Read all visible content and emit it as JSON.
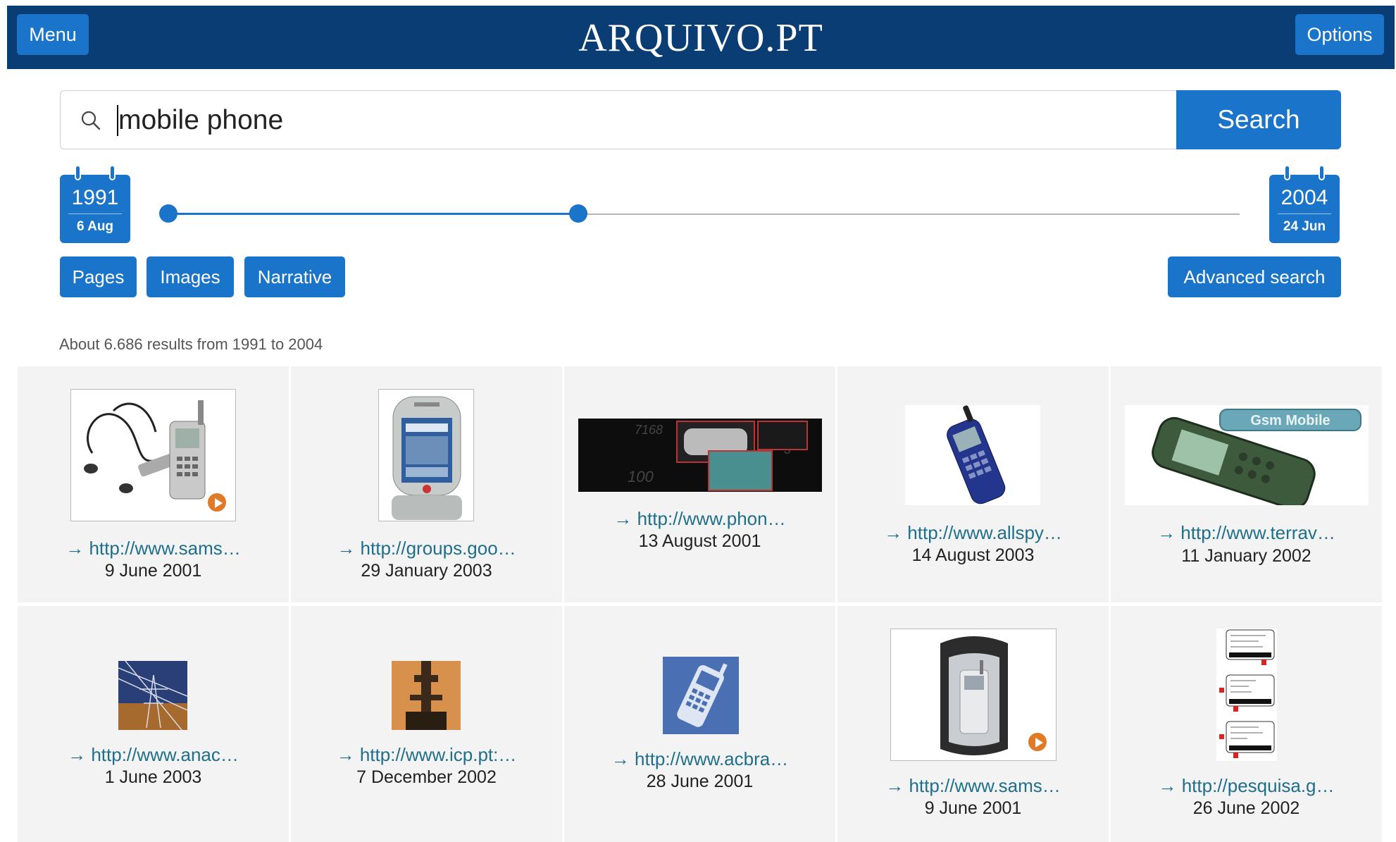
{
  "header": {
    "menu_label": "Menu",
    "logo_text": "ARQUIVO.PT",
    "options_label": "Options"
  },
  "search": {
    "query": "mobile phone",
    "button_label": "Search"
  },
  "date_range": {
    "start": {
      "year": "1991",
      "day": "6 Aug"
    },
    "end": {
      "year": "2004",
      "day": "24 Jun"
    },
    "selected_fraction": [
      0.0,
      0.4
    ]
  },
  "tabs": {
    "pages": "Pages",
    "images": "Images",
    "narrative": "Narrative",
    "advanced": "Advanced search"
  },
  "results_summary": "About 6.686 results from 1991 to 2004",
  "results": [
    {
      "url": "→ http://www.sams…",
      "date": "9 June 2001",
      "thumb": "phone-with-earphones",
      "video": true
    },
    {
      "url": "→ http://groups.goo…",
      "date": "29 January 2003",
      "thumb": "samsung-flip-phone",
      "video": false
    },
    {
      "url": "→ http://www.phon…",
      "date": "13 August 2001",
      "thumb": "dark-keypad-banner",
      "video": false
    },
    {
      "url": "→ http://www.allspy…",
      "date": "14 August 2003",
      "thumb": "blue-mobile-phone",
      "video": false
    },
    {
      "url": "→ http://www.terrav…",
      "date": "11 January 2002",
      "thumb": "gsm-mobile-banner",
      "video": false,
      "banner_text": "Gsm Mobile"
    },
    {
      "url": "→ http://www.anac…",
      "date": "1 June 2003",
      "thumb": "power-pylon",
      "video": false
    },
    {
      "url": "→ http://www.icp.pt:…",
      "date": "7 December 2002",
      "thumb": "antenna-tower",
      "video": false
    },
    {
      "url": "→ http://www.acbra…",
      "date": "28 June 2001",
      "thumb": "blue-phone-icon",
      "video": false
    },
    {
      "url": "→ http://www.sams…",
      "date": "9 June 2001",
      "thumb": "phone-in-case",
      "video": true
    },
    {
      "url": "→ http://pesquisa.g…",
      "date": "26 June 2002",
      "thumb": "phone-screens-diagram",
      "video": false
    }
  ]
}
